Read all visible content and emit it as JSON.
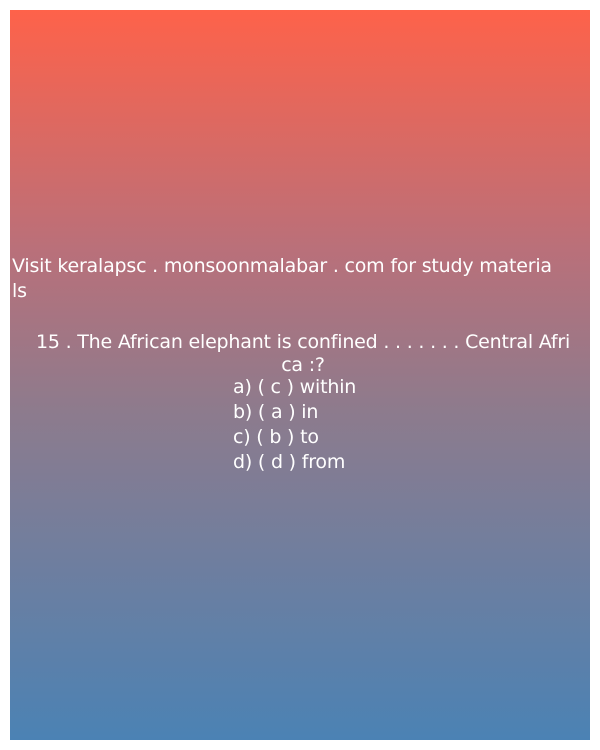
{
  "promo": {
    "line1": "Visit keralapsc . monsoonmalabar . com for study materia",
    "line2": "ls"
  },
  "question": {
    "line1": "15 . The African elephant is confined . . . . . . . Central Afri",
    "line2": "ca :?"
  },
  "options": [
    "a) ( c ) within",
    "b) ( a ) in",
    "c) ( b ) to",
    "d) ( d ) from"
  ],
  "colors": {
    "gradient_top": "#fe624a",
    "gradient_bottom": "#4b82b4",
    "text": "#ffffff"
  }
}
